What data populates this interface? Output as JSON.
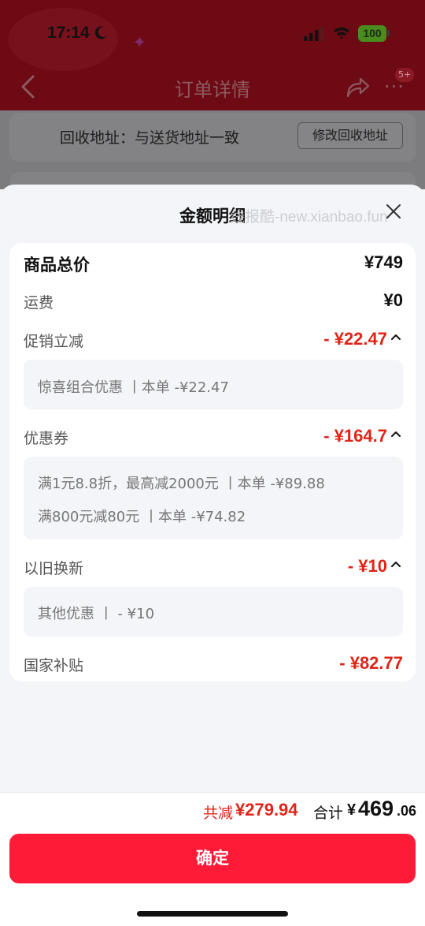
{
  "status_bar": {
    "time": "17:14",
    "battery": "100"
  },
  "nav": {
    "title": "订单详情",
    "badge": "5+",
    "more": "···"
  },
  "background": {
    "address_text": "回收地址：与送货地址一致",
    "address_button": "修改回收地址"
  },
  "sheet": {
    "title": "金额明细",
    "watermark": "线报酷-new.xianbao.fun"
  },
  "details": {
    "goods_total": {
      "label": "商品总价",
      "value": "¥749"
    },
    "shipping": {
      "label": "运费",
      "value": "¥0"
    },
    "promotion": {
      "label": "促销立减",
      "value": "- ¥22.47",
      "items": [
        "惊喜组合优惠 丨本单 -¥22.47"
      ]
    },
    "coupon": {
      "label": "优惠券",
      "value": "- ¥164.7",
      "items": [
        "满1元8.8折，最高减2000元 丨本单 -¥89.88",
        "满800元减80元 丨本单 -¥74.82"
      ]
    },
    "tradein": {
      "label": "以旧换新",
      "value": "- ¥10",
      "items": [
        "其他优惠 丨 - ¥10"
      ]
    },
    "subsidy": {
      "label": "国家补贴",
      "value": "- ¥82.77"
    }
  },
  "footer": {
    "saved_label": "共减",
    "saved_value": "¥279.94",
    "total_label": "合计",
    "total_currency": "¥",
    "total_integer": "469",
    "total_decimal": ".06",
    "confirm_label": "确定"
  },
  "colors": {
    "accent": "#fe1b37",
    "discount": "#e02417"
  }
}
